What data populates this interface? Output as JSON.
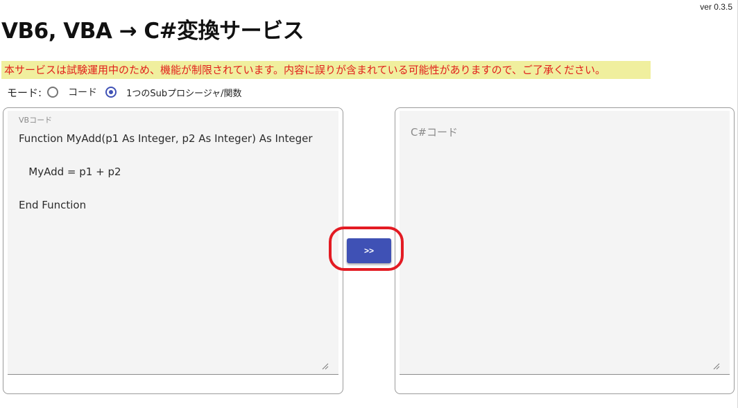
{
  "app": {
    "version": "ver 0.3.5",
    "title": "VB6, VBA → C#変換サービス"
  },
  "notice": {
    "text": "本サービスは試験運用中のため、機能が制限されています。内容に誤りが含まれている可能性がありますので、ご了承ください。",
    "background": "#f0ef9e",
    "color": "#e0211c"
  },
  "mode": {
    "label": "モード:",
    "options": [
      {
        "label": "コード",
        "selected": false
      },
      {
        "label": "1つのSubプロシージャ/関数",
        "selected": true
      }
    ]
  },
  "vb_panel": {
    "label": "VBコード",
    "code": "Function MyAdd(p1 As Integer, p2 As Integer) As Integer\n\n   MyAdd = p1 + p2\n\nEnd Function"
  },
  "cs_panel": {
    "placeholder": "C#コード",
    "code": ""
  },
  "convert_button": {
    "label": ">>",
    "color": "#3f51b5"
  },
  "annotation": {
    "color": "#e31b23"
  }
}
